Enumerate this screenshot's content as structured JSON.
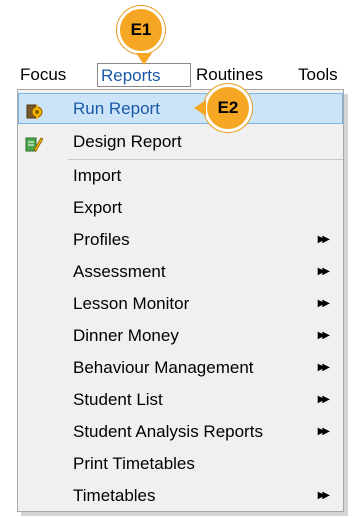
{
  "menubar": {
    "items": [
      "Focus",
      "Reports",
      "Routines",
      "Tools"
    ]
  },
  "reports_menu": {
    "items": [
      {
        "label": "Run Report",
        "icon": "run-report-icon",
        "selected": true
      },
      {
        "label": "Design Report",
        "icon": "design-report-icon"
      },
      {
        "label": "Import"
      },
      {
        "label": "Export"
      },
      {
        "label": "Profiles",
        "submenu": true
      },
      {
        "label": "Assessment",
        "submenu": true
      },
      {
        "label": "Lesson Monitor",
        "submenu": true
      },
      {
        "label": "Dinner Money",
        "submenu": true
      },
      {
        "label": "Behaviour Management",
        "submenu": true
      },
      {
        "label": "Student List",
        "submenu": true
      },
      {
        "label": "Student Analysis Reports",
        "submenu": true
      },
      {
        "label": "Print Timetables"
      },
      {
        "label": "Timetables",
        "submenu": true
      }
    ],
    "submenu_glyph": "▶▶"
  },
  "annotations": {
    "e1": "E1",
    "e2": "E2"
  },
  "colors": {
    "badge": "#f5a623",
    "highlight": "#cce4f7",
    "accent_text": "#1a5aa8"
  }
}
